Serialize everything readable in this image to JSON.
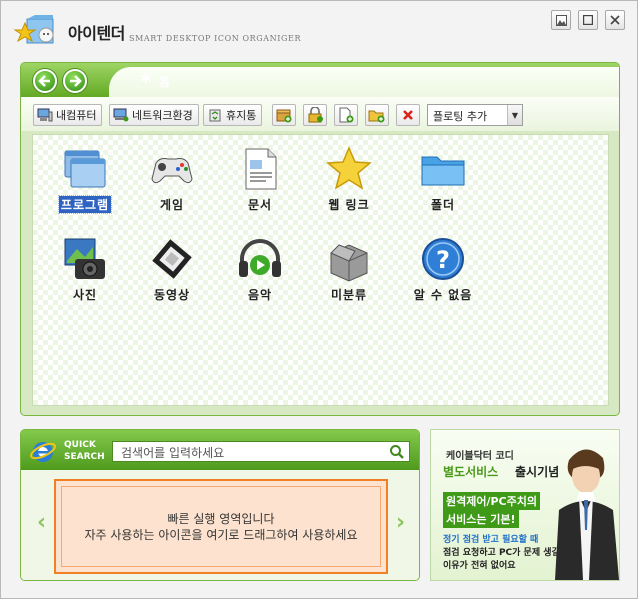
{
  "app": {
    "title": "아이텐더",
    "subtitle": "SMART DESKTOP ICON ORGANIGER"
  },
  "nav": {
    "home_label": "홈",
    "home_symbol": "✱"
  },
  "toolbar": {
    "my_computer": "내컴퓨터",
    "network": "네트워크환경",
    "recycle_bin": "휴지통",
    "select_value": "플로팅 추가"
  },
  "tiles": [
    {
      "label": "프로그램",
      "icon": "program-window-icon",
      "selected": true
    },
    {
      "label": "게임",
      "icon": "gamepad-icon"
    },
    {
      "label": "문서",
      "icon": "document-icon"
    },
    {
      "label": "웹 링크",
      "icon": "star-icon"
    },
    {
      "label": "폴더",
      "icon": "folder-icon"
    },
    {
      "label": "사진",
      "icon": "camera-icon"
    },
    {
      "label": "동영상",
      "icon": "film-icon"
    },
    {
      "label": "음악",
      "icon": "headphones-icon"
    },
    {
      "label": "미분류",
      "icon": "box-icon"
    },
    {
      "label": "알 수 없음",
      "icon": "question-icon"
    }
  ],
  "quick_search": {
    "title_line1": "QUICK",
    "title_line2": "SEARCH",
    "placeholder": "검색어를 입력하세요",
    "drop_line1": "빠른 실행 영역입니다",
    "drop_line2": "자주 사용하는 아이콘을 여기로 드래그하여 사용하세요",
    "left_arrow": "‹",
    "right_arrow": "›"
  },
  "ad": {
    "line1": "케이블닥터 코디",
    "line2a": "별도서비스",
    "line2b": "출시기념",
    "box1": "원격제어/PC주치의",
    "box2": "서비스는 기본!",
    "line3": "정기 점검 받고 필요할 때",
    "line4": "점검 요청하고 PC가 문제 생길",
    "line5": "이유가 전혀 없어요"
  },
  "colors": {
    "accent_green": "#63a924",
    "selection_blue": "#2f63c2",
    "drop_orange": "#f07f25"
  }
}
